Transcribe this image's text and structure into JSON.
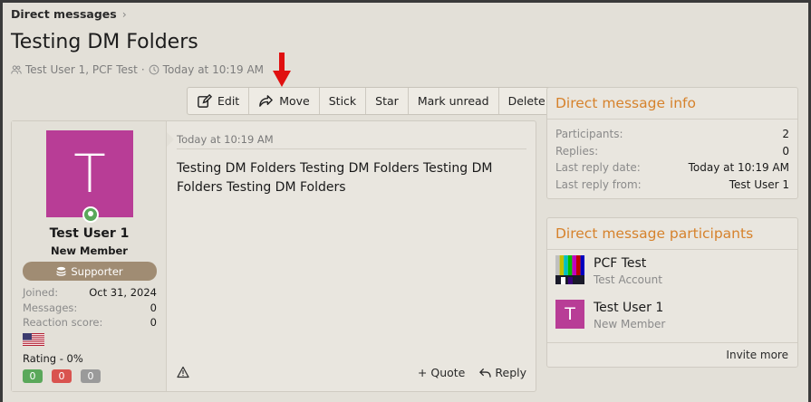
{
  "breadcrumb": {
    "label": "Direct messages"
  },
  "page": {
    "title": "Testing DM Folders",
    "participants_meta": "Test User 1, PCF Test",
    "sep": "·",
    "time_meta": "Today at 10:19 AM"
  },
  "toolbar": {
    "edit": "Edit",
    "move": "Move",
    "stick": "Stick",
    "star": "Star",
    "mark_unread": "Mark unread",
    "delete": "Delete"
  },
  "post": {
    "author": {
      "initial": "T",
      "name": "Test User 1",
      "title": "New Member",
      "banner": "Supporter",
      "stats": [
        {
          "label": "Joined:",
          "value": "Oct 31, 2024"
        },
        {
          "label": "Messages:",
          "value": "0"
        },
        {
          "label": "Reaction score:",
          "value": "0"
        }
      ],
      "rating": "Rating - 0%",
      "chips": [
        "0",
        "0",
        "0"
      ]
    },
    "date": "Today at 10:19 AM",
    "body": "Testing DM Folders Testing DM Folders Testing DM Folders Testing DM Folders",
    "quote": "Quote",
    "reply": "Reply"
  },
  "info_panel": {
    "title": "Direct message info",
    "rows": [
      {
        "label": "Participants:",
        "value": "2"
      },
      {
        "label": "Replies:",
        "value": "0"
      },
      {
        "label": "Last reply date:",
        "value": "Today at 10:19 AM"
      },
      {
        "label": "Last reply from:",
        "value": "Test User 1"
      }
    ]
  },
  "participants_panel": {
    "title": "Direct message participants",
    "people": [
      {
        "name": "PCF Test",
        "sub": "Test Account"
      },
      {
        "name": "Test User 1",
        "sub": "New Member",
        "initial": "T"
      }
    ],
    "invite": "Invite more"
  },
  "colors": {
    "accent": "#d6822c",
    "avatar": "#b83d96",
    "banner": "#a08c73",
    "arrow": "#e01010",
    "chip_green": "#5aa85a",
    "chip_red": "#d9534f",
    "chip_grey": "#9a9a9a"
  }
}
